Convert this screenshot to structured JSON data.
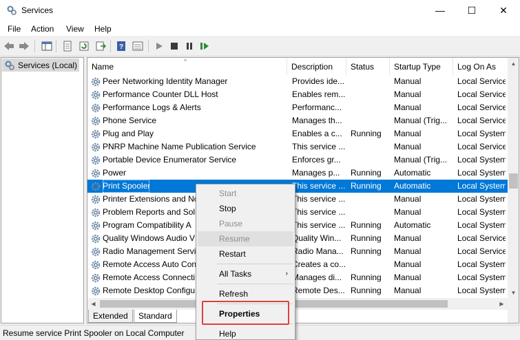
{
  "window": {
    "title": "Services",
    "min_glyph": "—",
    "max_glyph": "☐",
    "close_glyph": "✕"
  },
  "menubar": {
    "items": [
      "File",
      "Action",
      "View",
      "Help"
    ]
  },
  "tree": {
    "item": "Services (Local)"
  },
  "columns": {
    "name": "Name",
    "description": "Description",
    "status": "Status",
    "startup": "Startup Type",
    "logon": "Log On As",
    "sort_indicator": "^"
  },
  "rows": [
    {
      "name": "Peer Networking Identity Manager",
      "desc": "Provides ide...",
      "status": "",
      "startup": "Manual",
      "logon": "Local Service"
    },
    {
      "name": "Performance Counter DLL Host",
      "desc": "Enables rem...",
      "status": "",
      "startup": "Manual",
      "logon": "Local Service"
    },
    {
      "name": "Performance Logs & Alerts",
      "desc": "Performanc...",
      "status": "",
      "startup": "Manual",
      "logon": "Local Service"
    },
    {
      "name": "Phone Service",
      "desc": "Manages th...",
      "status": "",
      "startup": "Manual (Trig...",
      "logon": "Local Service"
    },
    {
      "name": "Plug and Play",
      "desc": "Enables a c...",
      "status": "Running",
      "startup": "Manual",
      "logon": "Local System"
    },
    {
      "name": "PNRP Machine Name Publication Service",
      "desc": "This service ...",
      "status": "",
      "startup": "Manual",
      "logon": "Local Service"
    },
    {
      "name": "Portable Device Enumerator Service",
      "desc": "Enforces gr...",
      "status": "",
      "startup": "Manual (Trig...",
      "logon": "Local System"
    },
    {
      "name": "Power",
      "desc": "Manages p...",
      "status": "Running",
      "startup": "Automatic",
      "logon": "Local System"
    },
    {
      "name": "Print Spooler",
      "desc": "This service ...",
      "status": "Running",
      "startup": "Automatic",
      "logon": "Local System"
    },
    {
      "name": "Printer Extensions and No",
      "desc": "This service ...",
      "status": "",
      "startup": "Manual",
      "logon": "Local System"
    },
    {
      "name": "Problem Reports and Solu",
      "desc": "This service ...",
      "status": "",
      "startup": "Manual",
      "logon": "Local System"
    },
    {
      "name": "Program Compatibility A",
      "desc": "This service ...",
      "status": "Running",
      "startup": "Automatic",
      "logon": "Local System"
    },
    {
      "name": "Quality Windows Audio V",
      "desc": "Quality Win...",
      "status": "Running",
      "startup": "Manual",
      "logon": "Local Service"
    },
    {
      "name": "Radio Management Servi",
      "desc": "Radio Mana...",
      "status": "Running",
      "startup": "Manual",
      "logon": "Local Service"
    },
    {
      "name": "Remote Access Auto Con",
      "desc": "Creates a co...",
      "status": "",
      "startup": "Manual",
      "logon": "Local System"
    },
    {
      "name": "Remote Access Connecti",
      "desc": "Manages di...",
      "status": "Running",
      "startup": "Manual",
      "logon": "Local System"
    },
    {
      "name": "Remote Desktop Configu",
      "desc": "Remote Des...",
      "status": "Running",
      "startup": "Manual",
      "logon": "Local System"
    }
  ],
  "tabs": {
    "extended": "Extended",
    "standard": "Standard"
  },
  "status_bar": {
    "text": "Resume service Print Spooler on Local Computer"
  },
  "context_menu": {
    "start": "Start",
    "stop": "Stop",
    "pause": "Pause",
    "resume": "Resume",
    "restart": "Restart",
    "all_tasks": "All Tasks",
    "refresh": "Refresh",
    "properties": "Properties",
    "help": "Help",
    "submenu_arrow": "›"
  },
  "colors": {
    "selection": "#0078d7",
    "highlight_box": "#e0413a"
  }
}
